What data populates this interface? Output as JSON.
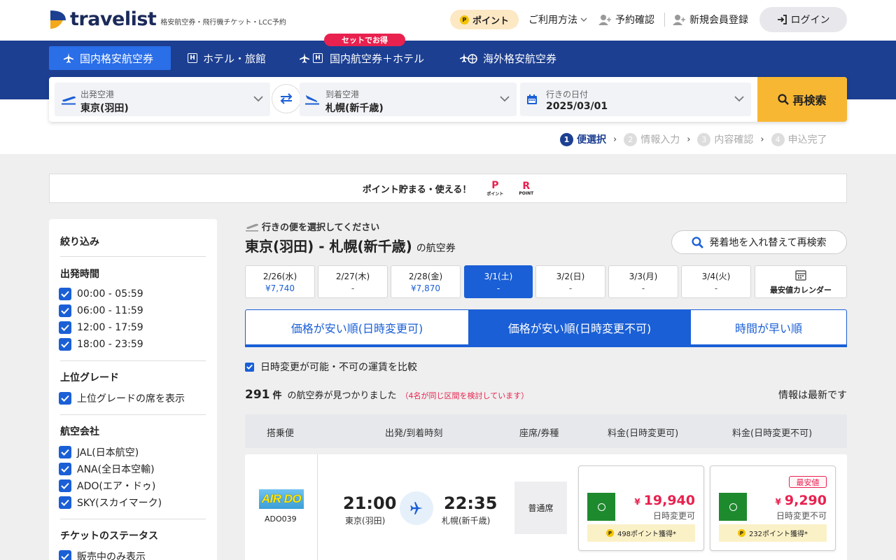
{
  "header": {
    "logo_text": "travelist",
    "logo_sub": "格安航空券・飛行機チケット・LCC予約",
    "point_label": "ポイント",
    "coin_glyph": "P",
    "usage_label": "ご利用方法",
    "reservation_label": "予約確認",
    "register_label": "新規会員登録",
    "login_label": "ログイン"
  },
  "nav": {
    "set_badge": "セットでお得",
    "tabs": [
      {
        "label": "国内格安航空券",
        "icon": "plane-icon",
        "active": true
      },
      {
        "label": "ホテル・旅館",
        "icon": "hotel-icon",
        "active": false
      },
      {
        "label": "国内航空券＋ホテル",
        "icon": "plane-hotel-icon",
        "active": false
      },
      {
        "label": "海外格安航空券",
        "icon": "globe-plane-icon",
        "active": false
      }
    ],
    "hotel_glyph": "H"
  },
  "search": {
    "departure_label": "出発空港",
    "departure_value": "東京(羽田)",
    "arrival_label": "到着空港",
    "arrival_value": "札幌(新千歳)",
    "date_label": "行きの日付",
    "date_value": "2025/03/01",
    "research_label": "再検索"
  },
  "steps": [
    {
      "num": "1",
      "label": "便選択",
      "active": true
    },
    {
      "num": "2",
      "label": "情報入力",
      "active": false
    },
    {
      "num": "3",
      "label": "内容確認",
      "active": false
    },
    {
      "num": "4",
      "label": "申込完了",
      "active": false
    }
  ],
  "point_banner": {
    "text": "ポイント貯まる・使える！",
    "logo1_mark": "P",
    "logo1_text": "ポイント",
    "logo2_mark": "R",
    "logo2_text": "POINT"
  },
  "sidebar": {
    "title": "絞り込み",
    "sections": {
      "time_title": "出発時間",
      "time_options": [
        "00:00 - 05:59",
        "06:00 - 11:59",
        "12:00 - 17:59",
        "18:00 - 23:59"
      ],
      "grade_title": "上位グレード",
      "grade_options": [
        "上位グレードの席を表示"
      ],
      "airline_title": "航空会社",
      "airline_options": [
        "JAL(日本航空)",
        "ANA(全日本空輸)",
        "ADO(エア・ドゥ)",
        "SKY(スカイマーク)"
      ],
      "status_title": "チケットのステータス",
      "status_options": [
        "販売中のみ表示"
      ]
    }
  },
  "main": {
    "subtitle": "行きの便を選択してください",
    "route": "東京(羽田) - 札幌(新千歳)",
    "route_suffix": "の航空券",
    "swap_search": "発着地を入れ替えて再検索",
    "dates": [
      {
        "date": "2/26(水)",
        "price": "¥7,740"
      },
      {
        "date": "2/27(木)",
        "price": "-"
      },
      {
        "date": "2/28(金)",
        "price": "¥7,870"
      },
      {
        "date": "3/1(土)",
        "price": "-",
        "selected": true
      },
      {
        "date": "3/2(日)",
        "price": "-"
      },
      {
        "date": "3/3(月)",
        "price": "-"
      },
      {
        "date": "3/4(火)",
        "price": "-"
      }
    ],
    "calendar_label": "最安値カレンダー",
    "sort_tabs": [
      "価格が安い順(日時変更可)",
      "価格が安い順(日時変更不可)",
      "時間が早い順"
    ],
    "compare_label": "日時変更が可能・不可の運賃を比較",
    "found_count": "291",
    "found_unit": "件",
    "found_text": "の航空券が見つかりました",
    "found_note": "（4名が同じ区間を検討しています）",
    "latest_info": "情報は最新です",
    "table_headers": [
      "搭乗便",
      "出発/到着時刻",
      "座席/券種",
      "料金(日時変更可)",
      "料金(日時変更不可)"
    ]
  },
  "flight": {
    "airline_logo": "AIR DO",
    "flight_no": "ADO039",
    "dep_time": "21:00",
    "dep_place": "東京(羽田)",
    "arr_time": "22:35",
    "arr_place": "札幌(新千歳)",
    "seat_type": "普通席",
    "fare_changeable": {
      "yen": "¥",
      "price": "19,940",
      "condition": "日時変更可",
      "points": "498ポイント獲得*"
    },
    "fare_fixed": {
      "yen": "¥",
      "price": "9,290",
      "condition": "日時変更不可",
      "points": "232ポイント獲得*",
      "badge": "最安値"
    }
  },
  "colors": {
    "brand_navy": "#1c3f91",
    "accent_blue": "#1a5fd6",
    "cta_orange": "#f8b733",
    "price_red": "#e8214f"
  }
}
